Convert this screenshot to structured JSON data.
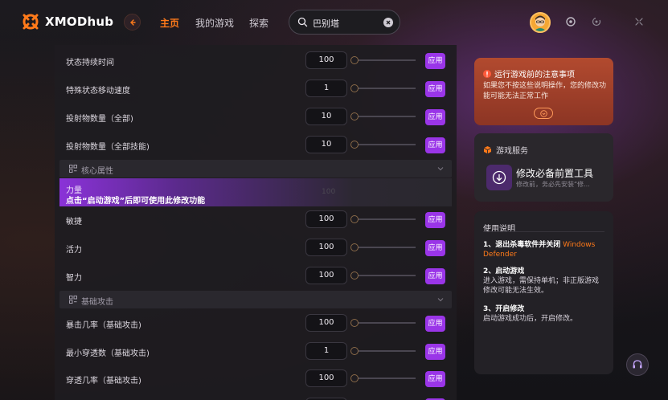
{
  "app": {
    "logo_text": "XMODhub",
    "accent_color": "#ff7a1a",
    "apply_color": "#9a35e8"
  },
  "nav": {
    "back_icon": "arrow-left-icon",
    "items": [
      {
        "label": "主页",
        "active": true
      },
      {
        "label": "我的游戏",
        "active": false
      },
      {
        "label": "探索",
        "active": false
      }
    ]
  },
  "search": {
    "value": "巴别塔",
    "icon": "search-icon",
    "clear_icon": "clear-icon"
  },
  "header_icons": [
    "avatar",
    "notification-icon",
    "minimize-icon",
    "maximize-icon"
  ],
  "main": {
    "apply_label": "应用",
    "rows_top": [
      {
        "label": "状态持续时间",
        "value": "100"
      },
      {
        "label": "特殊状态移动速度",
        "value": "1"
      },
      {
        "label": "投射物数量（全部)",
        "value": "10"
      },
      {
        "label": "投射物数量（全部技能)",
        "value": "10"
      }
    ],
    "section_core": "核心属性",
    "locked": {
      "name": "力量",
      "message": "点击“启动游戏”后即可使用此修改功能",
      "ghost_value": "100"
    },
    "rows_core": [
      {
        "label": "敏捷",
        "value": "100"
      },
      {
        "label": "活力",
        "value": "100"
      },
      {
        "label": "智力",
        "value": "100"
      }
    ],
    "section_basic": "基础攻击",
    "rows_basic": [
      {
        "label": "暴击几率（基础攻击)",
        "value": "100"
      },
      {
        "label": "最小穿透数（基础攻击)",
        "value": "1"
      },
      {
        "label": "穿透几率（基础攻击)",
        "value": "100"
      }
    ]
  },
  "notice": {
    "title": "运行游戏前的注意事项",
    "body": "如果您不按这些说明操作，您的修改功能可能无法正常工作"
  },
  "services": {
    "title": "游戏服务",
    "item_name": "修改必备前置工具",
    "item_desc": "修改前，务必先安装“修..."
  },
  "guide": {
    "title": "使用说明",
    "step1_title": "1、退出杀毒软件并关闭",
    "step1_highlight": "Windows Defender",
    "step2_title": "2、启动游戏",
    "step2_body": "进入游戏，需保持单机；非正版游戏修改可能无法生效。",
    "step3_title": "3、开启修改",
    "step3_body": "启动游戏成功后，开启修改。"
  }
}
